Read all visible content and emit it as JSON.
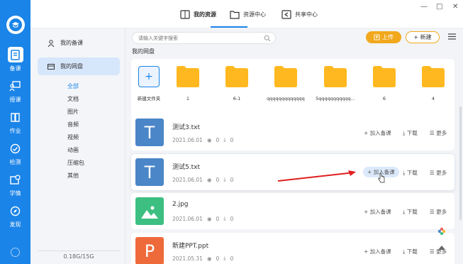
{
  "rail": {
    "items": [
      {
        "label": "备课",
        "icon": "book-icon"
      },
      {
        "label": "授课",
        "icon": "teach-icon"
      },
      {
        "label": "作业",
        "icon": "homework-icon"
      },
      {
        "label": "检测",
        "icon": "test-icon"
      },
      {
        "label": "学情",
        "icon": "analytics-icon"
      },
      {
        "label": "发现",
        "icon": "compass-icon"
      }
    ]
  },
  "topbar": {
    "tabs": [
      {
        "label": "我的资源",
        "icon": "book-icon"
      },
      {
        "label": "资源中心",
        "icon": "folder-icon"
      },
      {
        "label": "共享中心",
        "icon": "share-icon"
      }
    ],
    "window_controls": {
      "minimize": "—",
      "maximize": "□",
      "close": "✕"
    }
  },
  "sidebar": {
    "items": [
      {
        "label": "我的备课",
        "icon": "user-icon"
      },
      {
        "label": "我的网盘",
        "icon": "disk-icon"
      }
    ],
    "subitems": [
      "全部",
      "文档",
      "图片",
      "音频",
      "视频",
      "动画",
      "压缩包",
      "其他"
    ],
    "storage": "0.18G/15G"
  },
  "main": {
    "search_placeholder": "请输入关键字搜索",
    "upload_label": "上传",
    "new_label": "+ 新建",
    "section_title": "我的网盘",
    "new_folder_label": "新建文件夹",
    "folders": [
      "1",
      "6-1",
      "qqqqqqqqqqqqq",
      "5qqqqqqqqqqq...",
      "6",
      "4"
    ],
    "files": [
      {
        "name": "测试3.txt",
        "date": "2021.06.01",
        "views": "0",
        "downloads": "0",
        "type": "T",
        "color": "#4a86c8"
      },
      {
        "name": "测试5.txt",
        "date": "2021.06.01",
        "views": "0",
        "downloads": "0",
        "type": "T",
        "color": "#4a86c8"
      },
      {
        "name": "2.jpg",
        "date": "2021.06.01",
        "views": "0",
        "downloads": "0",
        "type": "img",
        "color": "#3dbf82"
      },
      {
        "name": "新建PPT.ppt",
        "date": "2021.05.31",
        "views": "0",
        "downloads": "0",
        "type": "P",
        "color": "#ef6a3b"
      }
    ],
    "actions": {
      "add": "加入备课",
      "download": "下载",
      "more": "更多"
    }
  },
  "colors": {
    "accent": "#1a84e8",
    "upload": "#f2a81d",
    "folder": "#ffb81f"
  }
}
